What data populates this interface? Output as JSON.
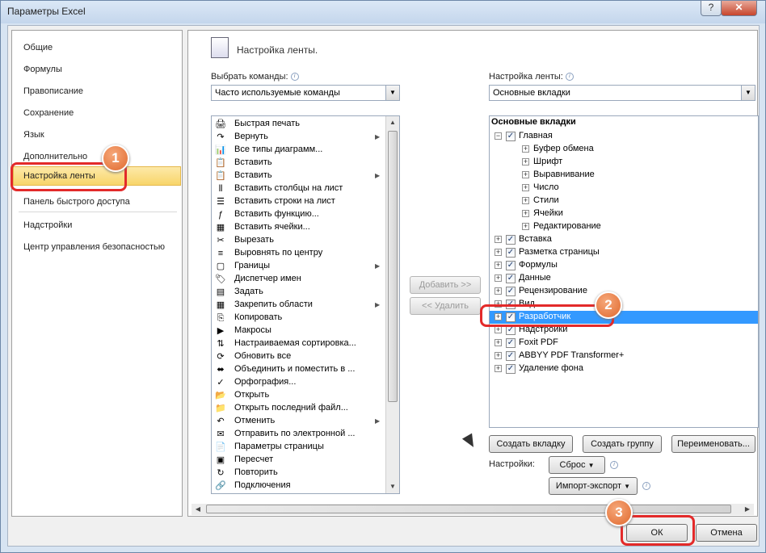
{
  "window": {
    "title": "Параметры Excel",
    "help_label": "?",
    "close_label": "✕"
  },
  "sidebar": {
    "items": [
      {
        "label": "Общие",
        "selected": false
      },
      {
        "label": "Формулы",
        "selected": false
      },
      {
        "label": "Правописание",
        "selected": false
      },
      {
        "label": "Сохранение",
        "selected": false
      },
      {
        "label": "Язык",
        "selected": false
      },
      {
        "label": "Дополнительно",
        "selected": false
      },
      {
        "label": "Настройка ленты",
        "selected": true
      },
      {
        "label": "Панель быстрого доступа",
        "selected": false
      },
      {
        "label": "Надстройки",
        "selected": false
      },
      {
        "label": "Центр управления безопасностью",
        "selected": false
      }
    ]
  },
  "main": {
    "header": "Настройка ленты.",
    "choose_commands": {
      "label": "Выбрать команды:",
      "value": "Часто используемые команды"
    },
    "customize_ribbon": {
      "label": "Настройка ленты:",
      "value": "Основные вкладки"
    },
    "commands": [
      {
        "label": "Быстрая печать",
        "icon": "🖨",
        "submenu": false
      },
      {
        "label": "Вернуть",
        "icon": "↷",
        "submenu": true
      },
      {
        "label": "Все типы диаграмм...",
        "icon": "📊",
        "submenu": false
      },
      {
        "label": "Вставить",
        "icon": "📋",
        "submenu": false
      },
      {
        "label": "Вставить",
        "icon": "📋",
        "submenu": true
      },
      {
        "label": "Вставить столбцы на лист",
        "icon": "⫴",
        "submenu": false
      },
      {
        "label": "Вставить строки на лист",
        "icon": "☰",
        "submenu": false
      },
      {
        "label": "Вставить функцию...",
        "icon": "ƒ",
        "submenu": false
      },
      {
        "label": "Вставить ячейки...",
        "icon": "▦",
        "submenu": false
      },
      {
        "label": "Вырезать",
        "icon": "✂",
        "submenu": false
      },
      {
        "label": "Выровнять по центру",
        "icon": "≡",
        "submenu": false
      },
      {
        "label": "Границы",
        "icon": "▢",
        "submenu": true
      },
      {
        "label": "Диспетчер имен",
        "icon": "🏷",
        "submenu": false
      },
      {
        "label": "Задать",
        "icon": "▤",
        "submenu": false
      },
      {
        "label": "Закрепить области",
        "icon": "▦",
        "submenu": true
      },
      {
        "label": "Копировать",
        "icon": "⎘",
        "submenu": false
      },
      {
        "label": "Макросы",
        "icon": "▶",
        "submenu": false
      },
      {
        "label": "Настраиваемая сортировка...",
        "icon": "⇅",
        "submenu": false
      },
      {
        "label": "Обновить все",
        "icon": "⟳",
        "submenu": false
      },
      {
        "label": "Объединить и поместить в ...",
        "icon": "⬌",
        "submenu": false
      },
      {
        "label": "Орфография...",
        "icon": "✓",
        "submenu": false
      },
      {
        "label": "Открыть",
        "icon": "📂",
        "submenu": false
      },
      {
        "label": "Открыть последний файл...",
        "icon": "📁",
        "submenu": false
      },
      {
        "label": "Отменить",
        "icon": "↶",
        "submenu": true
      },
      {
        "label": "Отправить по электронной ...",
        "icon": "✉",
        "submenu": false
      },
      {
        "label": "Параметры страницы",
        "icon": "📄",
        "submenu": false
      },
      {
        "label": "Пересчет",
        "icon": "▣",
        "submenu": false
      },
      {
        "label": "Повторить",
        "icon": "↻",
        "submenu": false
      },
      {
        "label": "Подключения",
        "icon": "🔗",
        "submenu": false
      }
    ],
    "add_button": "Добавить >>",
    "remove_button": "<< Удалить",
    "tabs_header": "Основные вкладки",
    "tabs_tree": [
      {
        "label": "Главная",
        "level": 0,
        "expander": "−",
        "checkbox": true,
        "checked": true,
        "selected": false
      },
      {
        "label": "Буфер обмена",
        "level": 1,
        "expander": "+",
        "checkbox": false,
        "selected": false
      },
      {
        "label": "Шрифт",
        "level": 1,
        "expander": "+",
        "checkbox": false,
        "selected": false
      },
      {
        "label": "Выравнивание",
        "level": 1,
        "expander": "+",
        "checkbox": false,
        "selected": false
      },
      {
        "label": "Число",
        "level": 1,
        "expander": "+",
        "checkbox": false,
        "selected": false
      },
      {
        "label": "Стили",
        "level": 1,
        "expander": "+",
        "checkbox": false,
        "selected": false
      },
      {
        "label": "Ячейки",
        "level": 1,
        "expander": "+",
        "checkbox": false,
        "selected": false
      },
      {
        "label": "Редактирование",
        "level": 1,
        "expander": "+",
        "checkbox": false,
        "selected": false
      },
      {
        "label": "Вставка",
        "level": 0,
        "expander": "+",
        "checkbox": true,
        "checked": true,
        "selected": false
      },
      {
        "label": "Разметка страницы",
        "level": 0,
        "expander": "+",
        "checkbox": true,
        "checked": true,
        "selected": false
      },
      {
        "label": "Формулы",
        "level": 0,
        "expander": "+",
        "checkbox": true,
        "checked": true,
        "selected": false
      },
      {
        "label": "Данные",
        "level": 0,
        "expander": "+",
        "checkbox": true,
        "checked": true,
        "selected": false
      },
      {
        "label": "Рецензирование",
        "level": 0,
        "expander": "+",
        "checkbox": true,
        "checked": true,
        "selected": false
      },
      {
        "label": "Вид",
        "level": 0,
        "expander": "+",
        "checkbox": true,
        "checked": true,
        "selected": false
      },
      {
        "label": "Разработчик",
        "level": 0,
        "expander": "+",
        "checkbox": true,
        "checked": true,
        "selected": true
      },
      {
        "label": "Надстройки",
        "level": 0,
        "expander": "+",
        "checkbox": true,
        "checked": true,
        "selected": false
      },
      {
        "label": "Foxit PDF",
        "level": 0,
        "expander": "+",
        "checkbox": true,
        "checked": true,
        "selected": false
      },
      {
        "label": "ABBYY PDF Transformer+",
        "level": 0,
        "expander": "+",
        "checkbox": true,
        "checked": true,
        "selected": false
      },
      {
        "label": "Удаление фона",
        "level": 0,
        "expander": "+",
        "checkbox": true,
        "checked": true,
        "selected": false
      }
    ],
    "new_tab_button": "Создать вкладку",
    "new_group_button": "Создать группу",
    "rename_button": "Переименовать...",
    "settings_label": "Настройки:",
    "reset_button": "Сброс",
    "import_export_button": "Импорт-экспорт"
  },
  "footer": {
    "ok_button": "ОК",
    "cancel_button": "Отмена"
  },
  "annotations": {
    "badge1": "1",
    "badge2": "2",
    "badge3": "3"
  },
  "colors": {
    "selection": "#3399ff",
    "highlight": "#f8d56a",
    "annotation_red": "#e32a2a",
    "badge_orange": "#e0692e"
  }
}
